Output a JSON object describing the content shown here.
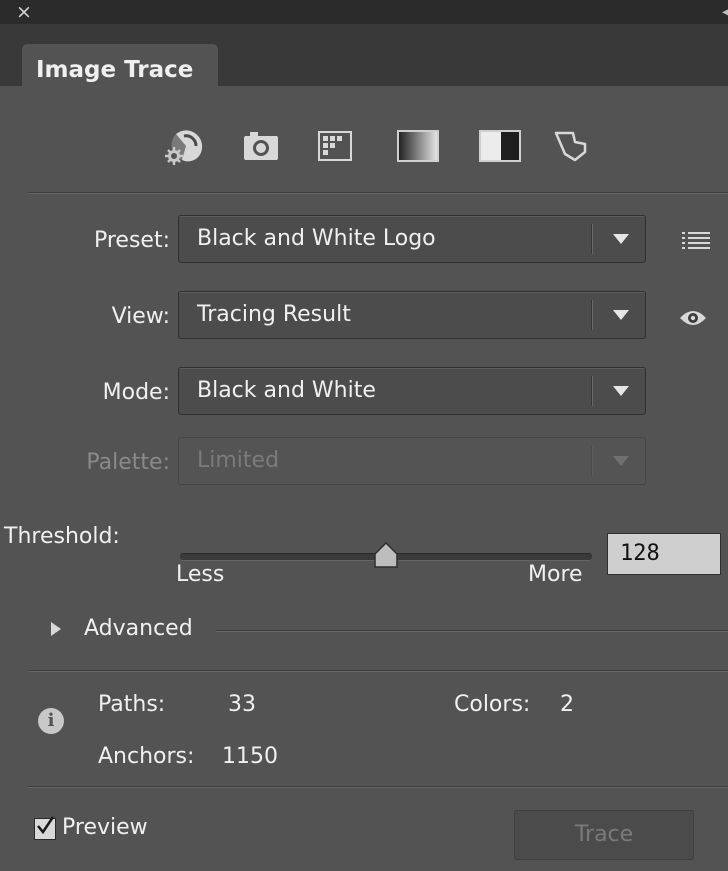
{
  "title_bar": {
    "close_glyph": "×",
    "collapse_glyph": "◂◂"
  },
  "tab": {
    "label": "Image Trace"
  },
  "presets": [
    {
      "name": "auto-color",
      "icon": "auto-color-icon"
    },
    {
      "name": "high-color",
      "icon": "camera-icon"
    },
    {
      "name": "low-color",
      "icon": "low-color-grid-icon"
    },
    {
      "name": "grayscale",
      "icon": "grayscale-gradient-icon"
    },
    {
      "name": "black-and-white",
      "icon": "black-white-icon"
    },
    {
      "name": "outline",
      "icon": "outline-shape-icon"
    }
  ],
  "preset": {
    "label": "Preset:",
    "value": "Black and White Logo",
    "menu_icon": "list-menu-icon"
  },
  "view": {
    "label": "View:",
    "value": "Tracing Result",
    "visibility_icon": "eye-icon"
  },
  "mode": {
    "label": "Mode:",
    "value": "Black and White"
  },
  "palette": {
    "label": "Palette:",
    "value": "Limited",
    "disabled": true
  },
  "threshold": {
    "label": "Threshold:",
    "value": "128",
    "min_label": "Less",
    "max_label": "More",
    "level_fraction": 0.5
  },
  "advanced": {
    "label": "Advanced",
    "expanded": false
  },
  "stats": {
    "paths_label": "Paths:",
    "paths_value": "33",
    "colors_label": "Colors:",
    "colors_value": "2",
    "anchors_label": "Anchors:",
    "anchors_value": "1150"
  },
  "preview": {
    "label": "Preview",
    "checked": true
  },
  "trace_button": {
    "label": "Trace",
    "enabled": false
  }
}
